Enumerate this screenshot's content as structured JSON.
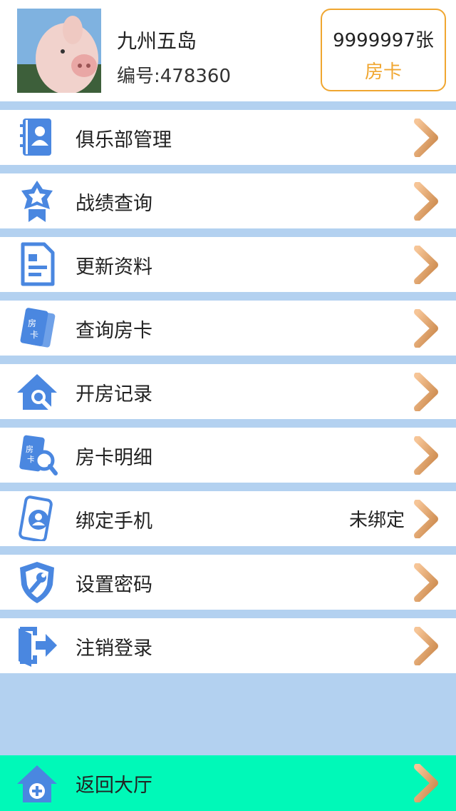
{
  "profile": {
    "name": "九州五岛",
    "id_text": "编号:478360"
  },
  "card": {
    "count": "9999997张",
    "label": "房卡"
  },
  "menu": [
    {
      "label": "俱乐部管理",
      "icon": "club-book-icon"
    },
    {
      "label": "战绩查询",
      "icon": "star-badge-icon"
    },
    {
      "label": "更新资料",
      "icon": "document-icon"
    },
    {
      "label": "查询房卡",
      "icon": "room-card-icon"
    },
    {
      "label": "开房记录",
      "icon": "house-search-icon"
    },
    {
      "label": "房卡明细",
      "icon": "room-card-search-icon"
    },
    {
      "label": "绑定手机",
      "icon": "phone-user-icon",
      "status": "未绑定"
    },
    {
      "label": "设置密码",
      "icon": "shield-wrench-icon"
    },
    {
      "label": "注销登录",
      "icon": "logout-door-icon"
    }
  ],
  "back": {
    "label": "返回大厅",
    "icon": "home-plus-icon"
  },
  "colors": {
    "page_bg": "#b3d1f0",
    "icon_blue": "#4a87e0",
    "card_accent": "#f0a630",
    "chevron": "#e3a06a",
    "back_bar": "#00f9b8"
  }
}
